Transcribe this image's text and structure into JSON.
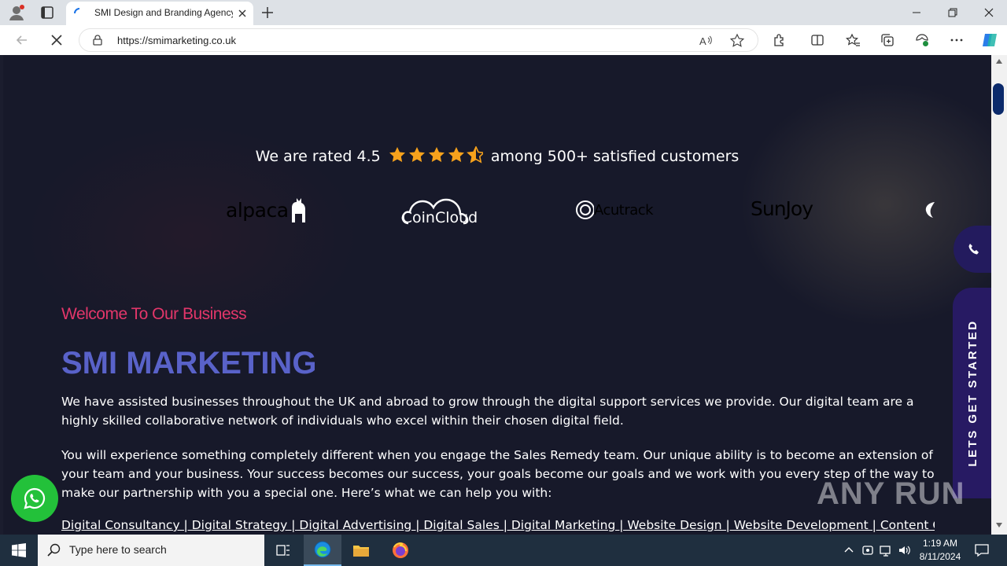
{
  "browser": {
    "tab_title": "SMI Design and Branding Agency",
    "url": "https://smimarketing.co.uk"
  },
  "page": {
    "rating": {
      "prefix": "We are rated 4.5",
      "value": 4.5,
      "suffix": "among 500+ satisfied customers",
      "star_color": "#f7a21c"
    },
    "logos": [
      "alpaca",
      "CoinCloud",
      "Acutrack",
      "SunJoy"
    ],
    "welcome": "Welcome To Our Business",
    "title": "SMI MARKETING",
    "paragraph1": "We have assisted businesses throughout the UK and abroad to grow through the digital support services we provide. Our digital team are a highly skilled collaborative network of individuals who excel within their chosen digital field.",
    "paragraph2": "You will experience something completely different when you engage the Sales Remedy team. Our unique ability is to become an extension of your team and your business. Your success becomes our success, your goals become our goals and we work with you every step of the way to make our partnership with you a special one. Here’s what we can help you with:",
    "services": "Digital Consultancy | Digital Strategy | Digital Advertising | Digital Sales | Digital Marketing | Website Design | Website Development | Content Creation |",
    "cta_label": "LETS GET STARTED",
    "colors": {
      "welcome": "#e3366a",
      "title": "#5962c9",
      "whatsapp": "#23c13a",
      "cta_bg": "#271a63"
    }
  },
  "watermark": "ANY RUN",
  "taskbar": {
    "search_placeholder": "Type here to search",
    "time": "1:19 AM",
    "date": "8/11/2024"
  }
}
